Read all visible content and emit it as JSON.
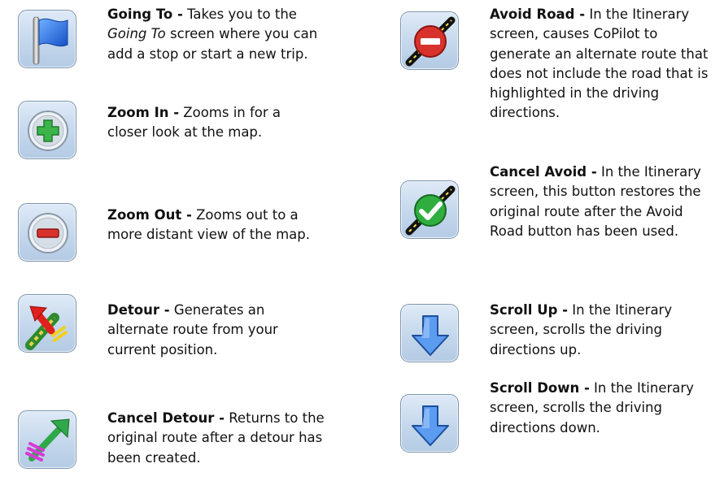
{
  "left_column": [
    {
      "title": "Going To -",
      "text_parts": [
        " Takes you to the ",
        "Going To",
        " screen where you can add a stop or start a new trip."
      ],
      "icon": "blue-flag-icon"
    },
    {
      "title": "Zoom In -",
      "text": " Zooms in for a closer look at the map.",
      "icon": "zoom-in-plus-icon"
    },
    {
      "title": "Zoom Out -",
      "text": " Zooms out to a more distant view of the map.",
      "icon": "zoom-out-minus-icon"
    },
    {
      "title": "Detour -",
      "text": " Generates an alternate route from your current position.",
      "icon": "detour-arrow-icon"
    },
    {
      "title": "Cancel Detour -",
      "text": " Returns to the original route after a detour has been created.",
      "icon": "cancel-detour-arrow-icon"
    }
  ],
  "right_column": [
    {
      "title": "Avoid Road -",
      "text": " In the Itinerary screen, causes CoPilot to generate an alternate route that does not include the road that is highlighted in the driving directions.",
      "icon": "avoid-road-icon"
    },
    {
      "title": "Cancel Avoid -",
      "text": " In the Itinerary screen, this button restores the original route after the Avoid Road button has been used.",
      "icon": "cancel-avoid-check-icon"
    },
    {
      "title": "Scroll Up -",
      "text": " In the Itinerary screen, scrolls the driving directions up.",
      "icon": "scroll-up-arrow-icon"
    },
    {
      "title": "Scroll Down -",
      "text": " In the Itinerary screen, scrolls the driving directions down.",
      "icon": "scroll-down-arrow-icon"
    }
  ],
  "colors": {
    "icon_bg": "#c4d7ec",
    "icon_border": "#7f96ad",
    "plus_green": "#3bb54a",
    "minus_red": "#d8322c",
    "arrow_blue": "#4f8fe0"
  }
}
